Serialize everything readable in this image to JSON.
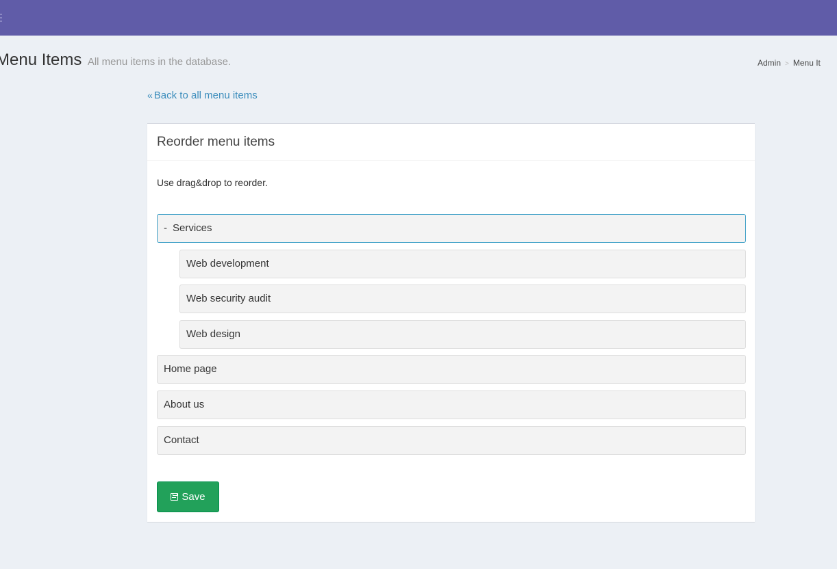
{
  "header": {
    "title": "Menu Items",
    "subtitle": "All menu items in the database."
  },
  "breadcrumb": {
    "items": [
      "Admin",
      "Menu It"
    ]
  },
  "back_link": {
    "label": "Back to all menu items"
  },
  "box": {
    "title": "Reorder menu items",
    "hint": "Use drag&drop to reorder."
  },
  "menu_items": [
    {
      "label": "Services",
      "toggle": "-",
      "depth": 0
    },
    {
      "label": "Web development",
      "depth": 1
    },
    {
      "label": "Web security audit",
      "depth": 1
    },
    {
      "label": "Web design",
      "depth": 1
    },
    {
      "label": "Home page",
      "depth": 0
    },
    {
      "label": "About us",
      "depth": 0
    },
    {
      "label": "Contact",
      "depth": 0
    }
  ],
  "save_button": {
    "label": "Save"
  },
  "colors": {
    "topbar": "#605ca8",
    "link": "#3c8dbc",
    "save": "#22a15a"
  }
}
